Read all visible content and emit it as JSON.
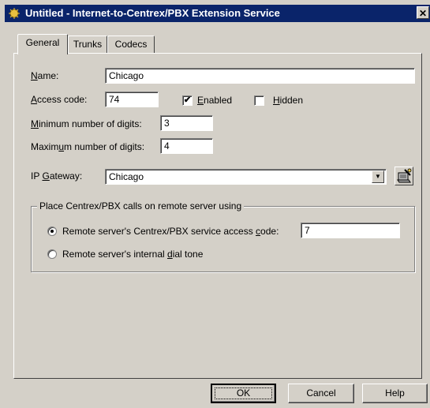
{
  "window": {
    "title": "Untitled - Internet-to-Centrex/PBX Extension Service",
    "close_glyph": "✕"
  },
  "tabs": [
    {
      "label": "General"
    },
    {
      "label": "Trunks"
    },
    {
      "label": "Codecs"
    }
  ],
  "general": {
    "name_label_pre": "",
    "name_label_ul": "N",
    "name_label_post": "ame:",
    "name_value": "Chicago",
    "access_label_pre": "",
    "access_label_ul": "A",
    "access_label_post": "ccess code:",
    "access_value": "74",
    "enabled_pre": "",
    "enabled_ul": "E",
    "enabled_post": "nabled",
    "enabled_checked": "✔",
    "hidden_pre": "",
    "hidden_ul": "H",
    "hidden_post": "idden",
    "min_label_pre": "",
    "min_label_ul": "M",
    "min_label_post": "inimum number of digits:",
    "min_value": "3",
    "max_label_pre": "Maxim",
    "max_label_ul": "u",
    "max_label_post": "m number of digits:",
    "max_value": "4",
    "gateway_label_pre": "IP ",
    "gateway_label_ul": "G",
    "gateway_label_post": "ateway:",
    "gateway_value": "Chicago",
    "dropdown_glyph": "▼"
  },
  "group": {
    "title": "Place Centrex/PBX calls on remote server using",
    "option1_pre": "Remote server's Centrex/PBX service access ",
    "option1_ul": "c",
    "option1_post": "ode:",
    "option1_value": "7",
    "option2_pre": "Remote server's internal ",
    "option2_ul": "d",
    "option2_post": "ial tone"
  },
  "buttons": {
    "ok": "OK",
    "cancel": "Cancel",
    "help": "Help"
  },
  "colors": {
    "titlebar": "#0a246a",
    "dialog": "#d4d0c8"
  }
}
